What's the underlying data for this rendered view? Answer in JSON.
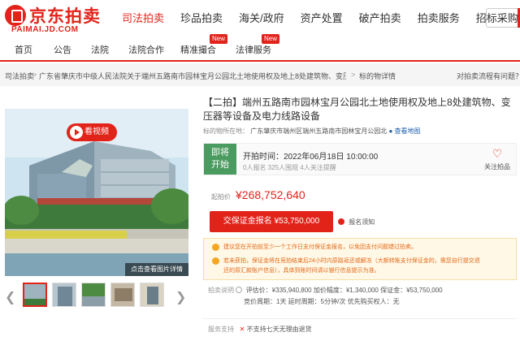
{
  "header": {
    "logo_text": "京东拍卖",
    "logo_url": "PAIMAI.JD.COM",
    "nav": [
      "司法拍卖",
      "珍品拍卖",
      "海关/政府",
      "资产处置",
      "破产拍卖",
      "拍卖服务",
      "招标采购"
    ]
  },
  "subnav": {
    "items": [
      "首页",
      "公告",
      "法院",
      "法院合作",
      "精准撮合",
      "法律服务"
    ],
    "new_tag": "New"
  },
  "breadcrumb": {
    "items": [
      "司法拍卖",
      "广东省肇庆市中级人民法院关于端州五路南市园林宝月公园北土地使用权及地上8处建筑物、变压器等设备及电...",
      "标的物详情"
    ],
    "right_link": "对拍卖流程有问题？"
  },
  "gallery": {
    "caption": "点击查看图片详情",
    "video_label": "看视频",
    "thumb_count": 5
  },
  "item": {
    "title": "【二拍】端州五路南市园林宝月公园北土地使用权及地上8处建筑物、变压器等设备及电力线路设备",
    "location_label": "标的物所在地：",
    "location_value": "广东肇庆市端州区端州五路南市园林宝月公园北",
    "map_link": "查看地图"
  },
  "auction": {
    "status": "即将开始",
    "status_line1": "即将",
    "status_line2": "开始",
    "start_time": "开拍时间：2022年06月18日 10:00:00",
    "counts": "0人报名   325人围观   4人关注提醒",
    "follow_label": "关注拍品"
  },
  "price": {
    "label": "起拍价",
    "value": "¥268,752,640"
  },
  "deposit": {
    "button": "交保证金报名 ¥53,750,000",
    "notice": "报名须知"
  },
  "tips": [
    "建议您在开拍前至少一个工作日支付保证金报名，以免因支付问题错过拍卖。",
    "若未获拍，保证金将在竞拍结束后24小时内原路返还或解冻（大额转账支付保证金的，需您自行提交退",
    "还的原汇款账户信息），具体到账时间请以银行信息提示为准。"
  ],
  "rules": {
    "label": "拍卖说明",
    "line1": "评估价：¥335,940,800     加价幅度：¥1,340,000     保证金：¥53,750,000",
    "line2": "竞价周期：1天     延时周期：5分钟/次     优先购买权人：无"
  },
  "service": {
    "label": "服务支持",
    "x": "✕",
    "text": "不支持七天无理由退货"
  },
  "colors": {
    "brand_red": "#e2231a",
    "status_green": "#4a9b5f",
    "tip_orange": "#e2691a"
  }
}
